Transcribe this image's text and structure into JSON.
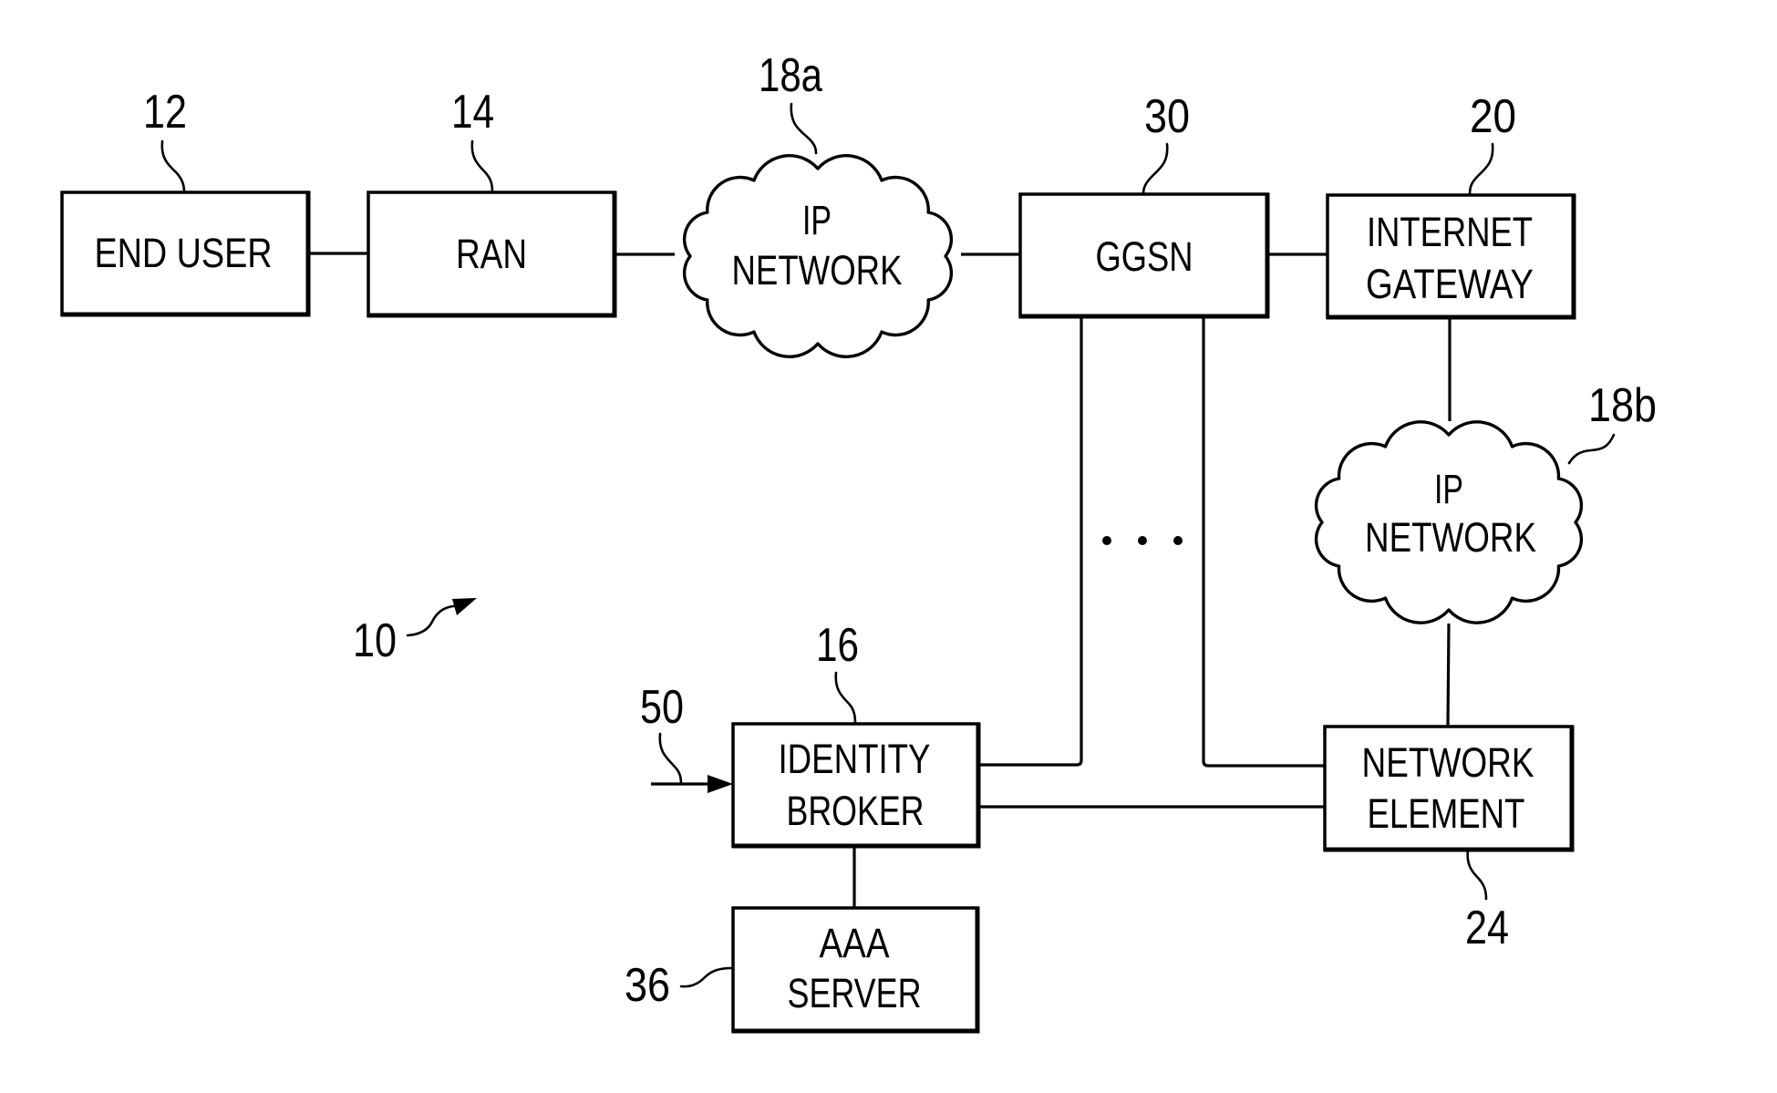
{
  "figure": {
    "system_ref": "10",
    "nodes": {
      "end_user": {
        "ref": "12",
        "lines": [
          "END USER"
        ]
      },
      "ran": {
        "ref": "14",
        "lines": [
          "RAN"
        ]
      },
      "ip_network_a": {
        "ref": "18a",
        "lines": [
          "IP",
          "NETWORK"
        ]
      },
      "ggsn": {
        "ref": "30",
        "lines": [
          "GGSN"
        ]
      },
      "internet_gateway": {
        "ref": "20",
        "lines": [
          "INTERNET",
          "GATEWAY"
        ]
      },
      "ip_network_b": {
        "ref": "18b",
        "lines": [
          "IP",
          "NETWORK"
        ]
      },
      "identity_broker": {
        "ref": "16",
        "lines": [
          "IDENTITY",
          "BROKER"
        ]
      },
      "network_element": {
        "ref": "24",
        "lines": [
          "NETWORK",
          "ELEMENT"
        ]
      },
      "aaa_server": {
        "ref": "36",
        "lines": [
          "AAA",
          "SERVER"
        ]
      }
    },
    "input_arrow_ref": "50",
    "ellipsis_icon": "three-dots"
  }
}
